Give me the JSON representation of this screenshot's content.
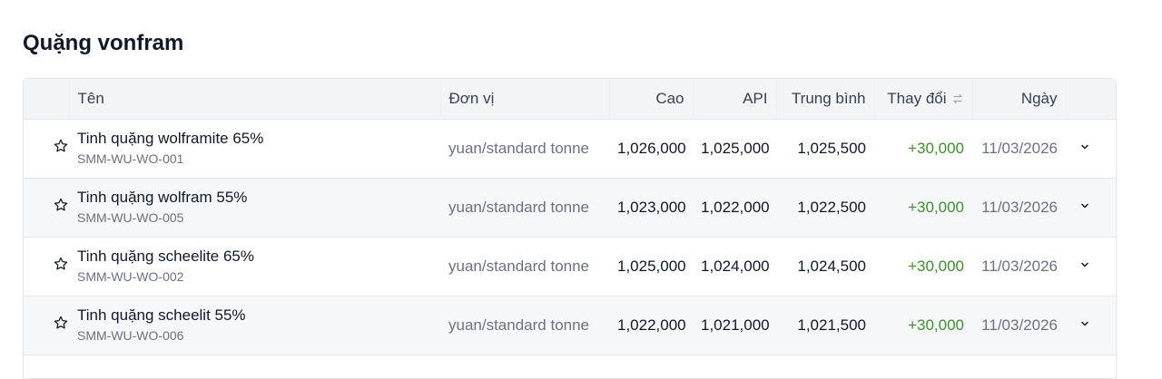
{
  "page": {
    "title": "Quặng vonfram"
  },
  "table": {
    "headers": {
      "name": "Tên",
      "unit": "Đơn vị",
      "high": "Cao",
      "api": "API",
      "avg": "Trung bình",
      "change": "Thay đổi",
      "date": "Ngày"
    },
    "rows": [
      {
        "name": "Tinh quặng wolframite 65%",
        "code": "SMM-WU-WO-001",
        "unit": "yuan/standard tonne",
        "high": "1,026,000",
        "api": "1,025,000",
        "avg": "1,025,500",
        "change": "+30,000",
        "date": "11/03/2026"
      },
      {
        "name": "Tinh quặng wolfram 55%",
        "code": "SMM-WU-WO-005",
        "unit": "yuan/standard tonne",
        "high": "1,023,000",
        "api": "1,022,000",
        "avg": "1,022,500",
        "change": "+30,000",
        "date": "11/03/2026"
      },
      {
        "name": "Tinh quặng scheelite 65%",
        "code": "SMM-WU-WO-002",
        "unit": "yuan/standard tonne",
        "high": "1,025,000",
        "api": "1,024,000",
        "avg": "1,024,500",
        "change": "+30,000",
        "date": "11/03/2026"
      },
      {
        "name": "Tinh quặng scheelit 55%",
        "code": "SMM-WU-WO-006",
        "unit": "yuan/standard tonne",
        "high": "1,022,000",
        "api": "1,021,000",
        "avg": "1,021,500",
        "change": "+30,000",
        "date": "11/03/2026"
      }
    ]
  },
  "icons": {
    "row_favorite": "star-icon",
    "row_expand": "chevron-down-icon",
    "sort": "sort-icon"
  },
  "colors": {
    "change_positive": "#3f8f2f",
    "header_bg": "#f3f4f6",
    "alt_row_bg": "#f6f7f9"
  }
}
